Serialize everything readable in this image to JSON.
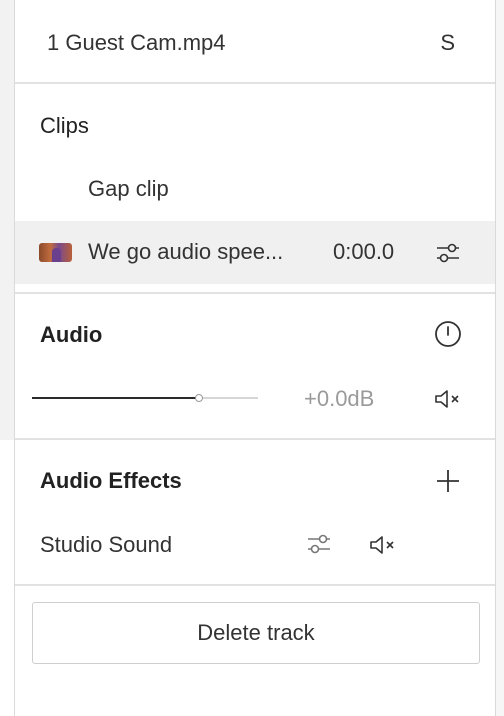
{
  "header": {
    "file_name": "1 Guest Cam.mp4",
    "shortcut": "S"
  },
  "clips": {
    "title": "Clips",
    "items": [
      {
        "name": "Gap clip"
      },
      {
        "name": "We go audio spee...",
        "time": "0:00.0",
        "selected": true
      }
    ]
  },
  "audio": {
    "title": "Audio",
    "gain_label": "+0.0dB",
    "volume_level": 0.74,
    "icons": {
      "timer": "timer-icon",
      "mute": "mute-icon"
    }
  },
  "audio_effects": {
    "title": "Audio Effects",
    "items": [
      {
        "name": "Studio Sound"
      }
    ]
  },
  "footer": {
    "delete_label": "Delete track"
  },
  "colors": {
    "selected_row_bg": "#f0f0f0",
    "slider_fill": "#2b2b2b",
    "muted_text": "#9a9a9a"
  }
}
